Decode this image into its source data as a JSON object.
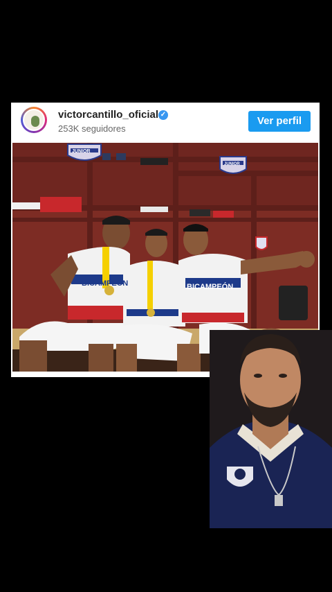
{
  "post": {
    "username": "victorcantillo_oficial",
    "followers": "253K seguidores",
    "view_profile_label": "Ver perfil",
    "photo_badges": [
      "JUNIOR"
    ],
    "jersey_text": [
      "BICAMPEÓN"
    ]
  },
  "icons": {
    "verified": "verified-badge-icon"
  },
  "colors": {
    "button": "#1a9bf0",
    "verified": "#3897f0",
    "background": "#000000"
  }
}
